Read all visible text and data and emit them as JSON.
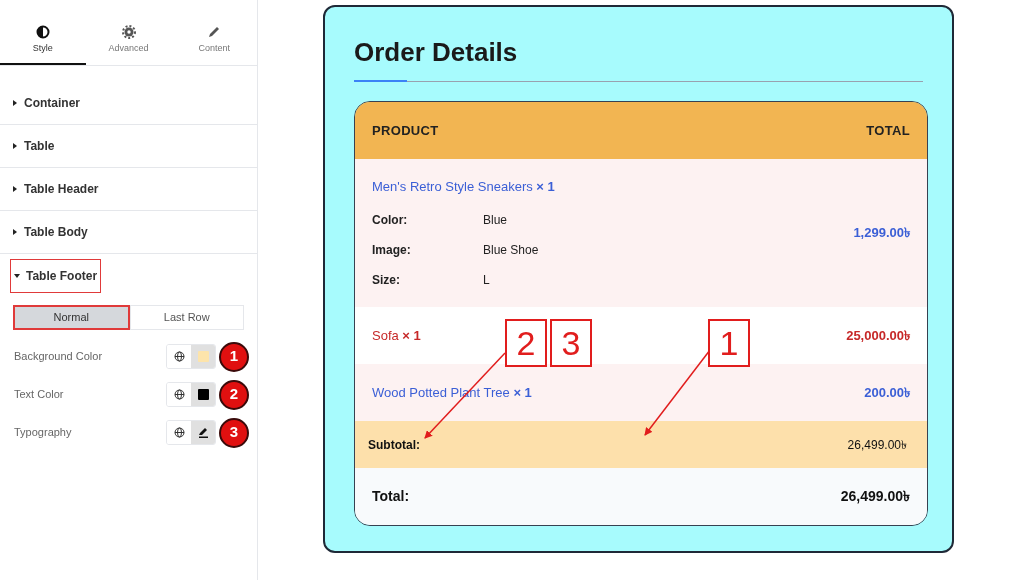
{
  "panel": {
    "tabs": [
      {
        "label": "Style",
        "selected": true
      },
      {
        "label": "Advanced",
        "selected": false
      },
      {
        "label": "Content",
        "selected": false
      }
    ],
    "sections": [
      {
        "label": "Container",
        "expanded": false
      },
      {
        "label": "Table",
        "expanded": false
      },
      {
        "label": "Table Header",
        "expanded": false
      },
      {
        "label": "Table Body",
        "expanded": false
      },
      {
        "label": "Table Footer",
        "expanded": true
      }
    ],
    "state_tabs": [
      {
        "label": "Normal",
        "selected": true
      },
      {
        "label": "Last Row",
        "selected": false
      }
    ],
    "controls": [
      {
        "label": "Background Color",
        "kind": "color",
        "color": "#fde4ab",
        "badge": "1"
      },
      {
        "label": "Text Color",
        "kind": "color",
        "color": "#000000",
        "badge": "2"
      },
      {
        "label": "Typography",
        "kind": "typography",
        "badge": "3"
      }
    ]
  },
  "order": {
    "title": "Order Details",
    "columns": [
      "PRODUCT",
      "TOTAL"
    ],
    "rows": [
      {
        "product": "Men's Retro Style Sneakers **× 1**",
        "color": "#3b5fd6",
        "total": "1,299.00৳",
        "meta": [
          {
            "key": "Color:",
            "value": "Blue"
          },
          {
            "key": "Image:",
            "value": "Blue Shoe"
          },
          {
            "key": "Size:",
            "value": "L"
          }
        ]
      },
      {
        "product": "Sofa **× 1**",
        "color": "#c62828",
        "total": "25,000.00৳"
      },
      {
        "product": "Wood Potted Plant Tree **× 1**",
        "color": "#3b5fd6",
        "total": "200.00৳"
      }
    ],
    "footer": [
      {
        "label": "Subtotal:",
        "value": "26,499.00৳"
      },
      {
        "label": "Total:",
        "value": "26,499.00৳"
      }
    ]
  },
  "callouts": [
    "2",
    "3",
    "1"
  ]
}
